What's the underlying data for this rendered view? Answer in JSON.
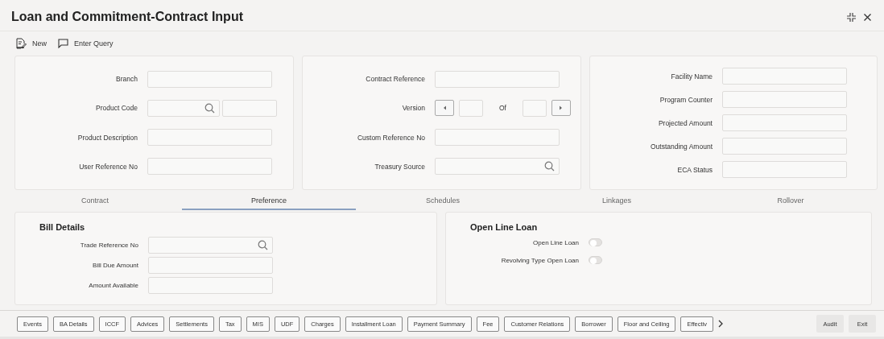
{
  "window": {
    "title": "Loan and Commitment-Contract Input"
  },
  "toolbar": [
    {
      "label": "New",
      "kind": "new"
    },
    {
      "label": "Enter Query",
      "kind": "query"
    }
  ],
  "panels": [
    {
      "fields": [
        {
          "label": "Branch",
          "kind": "text"
        },
        {
          "label": "Product Code",
          "kind": "lookup_pair"
        },
        {
          "label": "Product Description",
          "kind": "text"
        },
        {
          "label": "User Reference No",
          "kind": "text"
        }
      ]
    },
    {
      "fields": [
        {
          "label": "Contract Reference",
          "kind": "text"
        },
        {
          "label": "Version",
          "kind": "version",
          "of_label": "Of"
        },
        {
          "label": "Custom Reference No",
          "kind": "text"
        },
        {
          "label": "Treasury Source",
          "kind": "lookup"
        }
      ]
    },
    {
      "fields": [
        {
          "label": "Facility Name",
          "kind": "text"
        },
        {
          "label": "Program Counter",
          "kind": "text"
        },
        {
          "label": "Projected Amount",
          "kind": "text"
        },
        {
          "label": "Outstanding Amount",
          "kind": "text"
        },
        {
          "label": "ECA Status",
          "kind": "text"
        }
      ]
    }
  ],
  "tabs": [
    {
      "label": "Contract",
      "selected": false
    },
    {
      "label": "Preference",
      "selected": true
    },
    {
      "label": "Schedules",
      "selected": false
    },
    {
      "label": "Linkages",
      "selected": false
    },
    {
      "label": "Rollover",
      "selected": false
    }
  ],
  "bill_details": {
    "title": "Bill Details",
    "fields": [
      {
        "label": "Trade Reference No",
        "kind": "lookup"
      },
      {
        "label": "Bill Due Amount",
        "kind": "text"
      },
      {
        "label": "Amount Available",
        "kind": "text"
      }
    ]
  },
  "open_line_loan": {
    "title": "Open Line Loan",
    "toggles": [
      {
        "label": "Open Line Loan",
        "on": false
      },
      {
        "label": "Revolving Type Open Loan",
        "on": false
      }
    ]
  },
  "footer_buttons": [
    "Events",
    "BA Details",
    "ICCF",
    "Advices",
    "Settlements",
    "Tax",
    "MIS",
    "UDF",
    "Charges",
    "Installment Loan",
    "Payment Summary",
    "Fee",
    "Customer Relations",
    "Borrower",
    "Floor and Ceiling",
    "Effectiv"
  ],
  "actions": [
    "Audit",
    "Exit"
  ]
}
